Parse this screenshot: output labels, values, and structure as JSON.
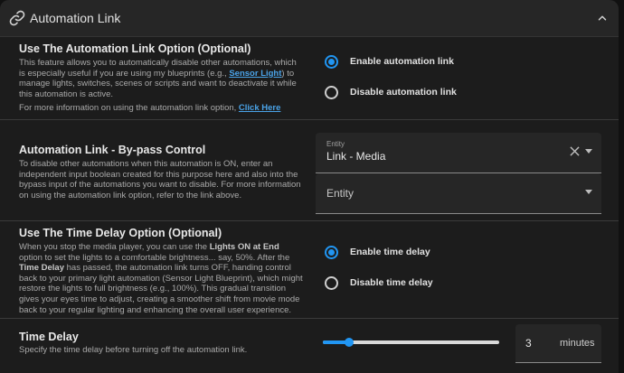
{
  "header": {
    "title": "Automation Link"
  },
  "link_option": {
    "title": "Use The Automation Link Option (Optional)",
    "desc_part1": "This feature allows you to automatically disable other automations, which is especially useful if you are using my blueprints (e.g., ",
    "desc_link": "Sensor Light",
    "desc_part2": ") to manage lights, switches, scenes or scripts and want to deactivate it while this automation is active.",
    "more_info_prefix": "For more information on using the automation link option, ",
    "more_info_link": "Click Here",
    "options": [
      {
        "label": "Enable automation link",
        "selected": true
      },
      {
        "label": "Disable automation link",
        "selected": false
      }
    ]
  },
  "bypass": {
    "title": "Automation Link - By-pass Control",
    "desc": "To disable other automations when this automation is ON, enter an independent input boolean created for this purpose here and also into the bypass input of the automations you want to disable. For more information on using the automation link option, refer to the link above.",
    "entity1": {
      "label": "Entity",
      "value": "Link - Media"
    },
    "entity2": {
      "placeholder": "Entity"
    }
  },
  "time_delay_option": {
    "title": "Use The Time Delay Option (Optional)",
    "d1": "When you stop the media player, you can use the ",
    "b1": "Lights ON at End",
    "d2": " option to set the lights to a comfortable brightness... say, 50%. After the ",
    "b2": "Time Delay",
    "d3": " has passed, the automation link turns OFF, handing control back to your primary light automation (Sensor Light Blueprint), which might restore the lights to full brightness (e.g., 100%). This gradual transition gives your eyes time to adjust, creating a smoother shift from movie mode back to your regular lighting and enhancing the overall user experience.",
    "options": [
      {
        "label": "Enable time delay",
        "selected": true
      },
      {
        "label": "Disable time delay",
        "selected": false
      }
    ]
  },
  "time_delay": {
    "title": "Time Delay",
    "desc": "Specify the time delay before turning off the automation link.",
    "value": "3",
    "unit": "minutes",
    "slider_fraction": 0.15
  },
  "colors": {
    "accent": "#2196f3",
    "background": "#1c1c1c",
    "link": "#4aa3e8"
  }
}
